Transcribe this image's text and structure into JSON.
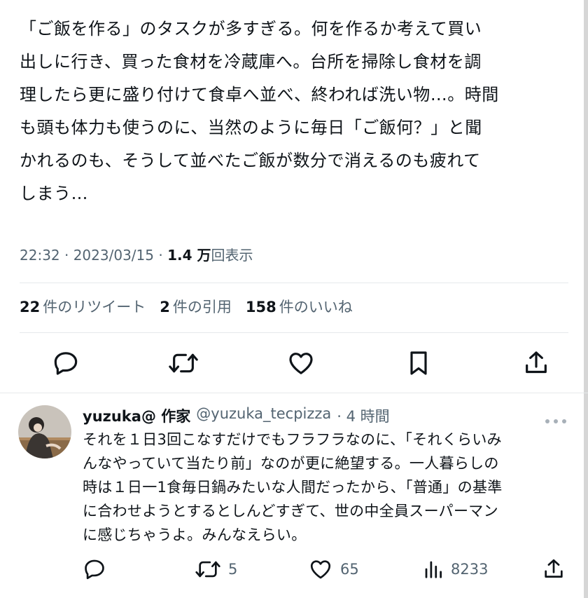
{
  "tweet": {
    "text": "「ご飯を作る」のタスクが多すぎる。何を作るか考えて買い\n出しに行き、買った食材を冷蔵庫へ。台所を掃除し食材を調\n理したら更に盛り付けて食卓へ並べ、終われば洗い物…。時間\nも頭も体力も使うのに、当然のように毎日「ご飯何？」と聞\nかれるのも、そうして並べたご飯が数分で消えるのも疲れて\nしまう…",
    "time": "22:32 · 2023/03/15 · ",
    "views_count": "1.4 万",
    "views_label": "回表示"
  },
  "stats": {
    "retweets_count": "22",
    "retweets_label": "件のリツイート",
    "quotes_count": "2",
    "quotes_label": "件の引用",
    "likes_count": "158",
    "likes_label": "件のいいね"
  },
  "actions": {
    "icons": [
      "reply-icon",
      "retweet-icon",
      "like-icon",
      "bookmark-icon",
      "share-icon"
    ]
  },
  "reply": {
    "name": "yuzuka@ 作家",
    "handle": "@yuzuka_tecpizza",
    "time": "· 4 時間",
    "text": "それを１日3回こなすだけでもフラフラなのに、「それくらいみ\nんなやっていて当たり前」なのが更に絶望する。一人暮らしの\n時は１日一1食毎日鍋みたいな人間だったから、「普通」の基準\nに合わせようとするとしんどすぎて、世の中全員スーパーマン\nに感じちゃうよ。みんなえらい。",
    "retweets": "5",
    "likes": "65",
    "views": "8233"
  },
  "colors": {
    "text": "#0f1419",
    "muted": "#536471",
    "divider": "#e6e9eb"
  }
}
